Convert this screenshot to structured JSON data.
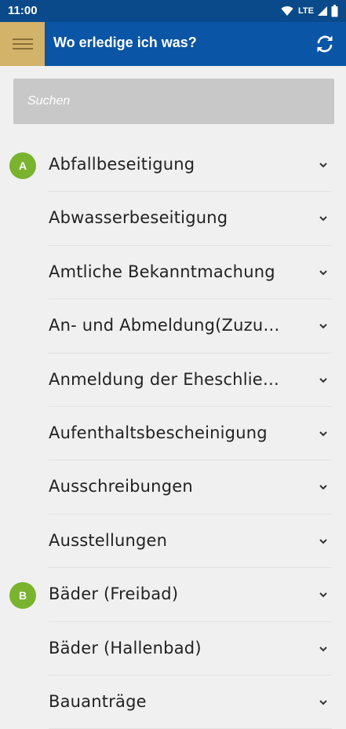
{
  "status_bar": {
    "time": "11:00",
    "network": "LTE",
    "icons": [
      "wifi-icon",
      "signal-icon",
      "battery-icon"
    ]
  },
  "app_bar": {
    "title": "Wo erledige ich was?",
    "menu_icon": "menu-icon",
    "refresh_icon": "refresh-icon",
    "colors": {
      "bar": "#0a55a5",
      "menu": "#d3b26a",
      "status": "#0a4a8a"
    }
  },
  "search": {
    "placeholder": "Suchen",
    "value": ""
  },
  "list": {
    "badge_color": "#7ab32e",
    "items": [
      {
        "letter": "A",
        "label": "Abfallbeseitigung"
      },
      {
        "letter": "",
        "label": "Abwasserbeseitigung"
      },
      {
        "letter": "",
        "label": "Amtliche Bekanntmachung"
      },
      {
        "letter": "",
        "label": "An- und Abmeldung(Zuzu…"
      },
      {
        "letter": "",
        "label": "Anmeldung der Eheschlie…"
      },
      {
        "letter": "",
        "label": "Aufenthaltsbescheinigung"
      },
      {
        "letter": "",
        "label": "Ausschreibungen"
      },
      {
        "letter": "",
        "label": "Ausstellungen"
      },
      {
        "letter": "B",
        "label": "Bäder (Freibad)"
      },
      {
        "letter": "",
        "label": "Bäder (Hallenbad)"
      },
      {
        "letter": "",
        "label": "Bauanträge"
      }
    ]
  }
}
